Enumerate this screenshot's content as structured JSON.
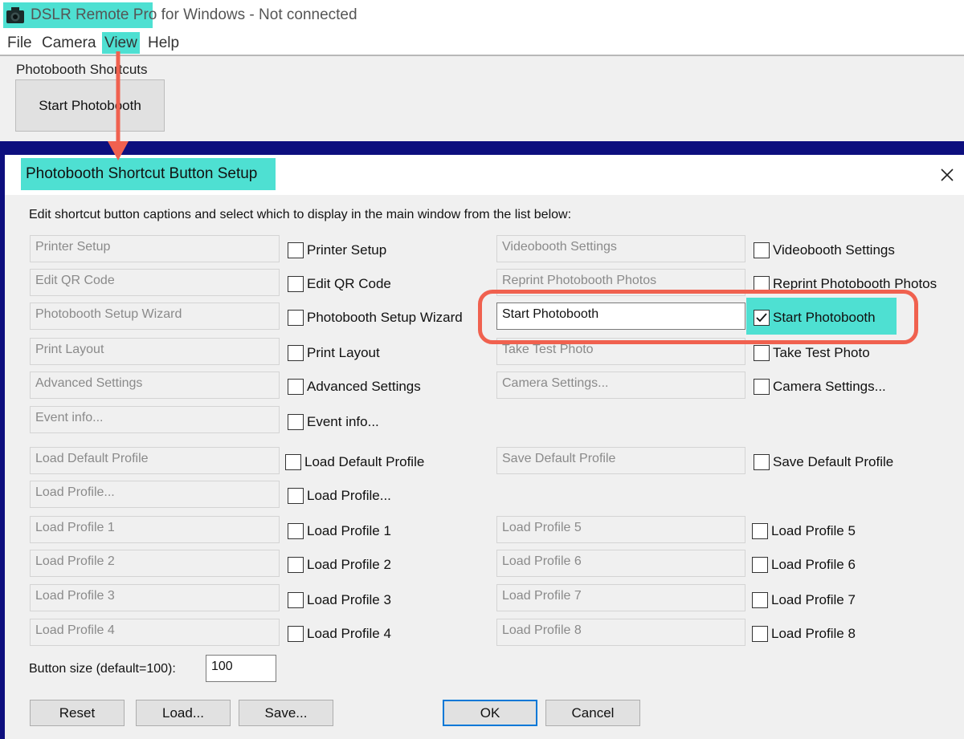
{
  "window": {
    "title_app": "DSLR Remote Pro",
    "title_rest": " for Windows - Not connected",
    "menu": [
      "File",
      "Camera",
      "View",
      "Help"
    ]
  },
  "main": {
    "group_label": "Photobooth Shortcuts",
    "shortcut_button": "Start Photobooth"
  },
  "dialog": {
    "title": "Photobooth Shortcut Button Setup",
    "instruction": "Edit shortcut button captions and select which to display in the main window from the list below:",
    "rows": [
      {
        "caption": "Printer Setup",
        "checkbox": "Printer Setup",
        "checked": false
      },
      {
        "caption": "Edit QR Code",
        "checkbox": "Edit QR Code",
        "checked": false
      },
      {
        "caption": "Photobooth Setup Wizard",
        "checkbox": "Photobooth Setup Wizard",
        "checked": false
      },
      {
        "caption": "Print Layout",
        "checkbox": "Print Layout",
        "checked": false
      },
      {
        "caption": "Advanced Settings",
        "checkbox": "Advanced Settings",
        "checked": false
      },
      {
        "caption": "Event info...",
        "checkbox": "Event info...",
        "checked": false
      },
      {
        "caption": "Load Default Profile",
        "checkbox": "Load Default Profile",
        "checked": false
      },
      {
        "caption": "Load Profile...",
        "checkbox": "Load Profile...",
        "checked": false
      },
      {
        "caption": "Load Profile 1",
        "checkbox": "Load Profile 1",
        "checked": false
      },
      {
        "caption": "Load Profile 2",
        "checkbox": "Load Profile 2",
        "checked": false
      },
      {
        "caption": "Load Profile 3",
        "checkbox": "Load Profile 3",
        "checked": false
      },
      {
        "caption": "Load Profile 4",
        "checkbox": "Load Profile 4",
        "checked": false
      },
      {
        "caption": "Videobooth Settings",
        "checkbox": "Videobooth Settings",
        "checked": false
      },
      {
        "caption": "Reprint Photobooth Photos",
        "checkbox": "Reprint Photobooth Photos",
        "checked": false
      },
      {
        "caption": "Start Photobooth",
        "checkbox": "Start Photobooth",
        "checked": true
      },
      {
        "caption": "Take Test Photo",
        "checkbox": "Take Test Photo",
        "checked": false
      },
      {
        "caption": "Camera Settings...",
        "checkbox": "Camera Settings...",
        "checked": false
      },
      {
        "caption": "Save Default Profile",
        "checkbox": "Save Default Profile",
        "checked": false
      },
      {
        "caption": "Load Profile 5",
        "checkbox": "Load Profile 5",
        "checked": false
      },
      {
        "caption": "Load Profile 6",
        "checkbox": "Load Profile 6",
        "checked": false
      },
      {
        "caption": "Load Profile 7",
        "checkbox": "Load Profile 7",
        "checked": false
      },
      {
        "caption": "Load Profile 8",
        "checkbox": "Load Profile 8",
        "checked": false
      }
    ],
    "button_size_label": "Button size (default=100):",
    "button_size_value": "100",
    "buttons": {
      "reset": "Reset",
      "load": "Load...",
      "save": "Save...",
      "ok": "OK",
      "cancel": "Cancel"
    }
  },
  "colors": {
    "highlight": "#4ee0d2",
    "annotation": "#f0614f",
    "backdrop": "#0d0f7e"
  }
}
